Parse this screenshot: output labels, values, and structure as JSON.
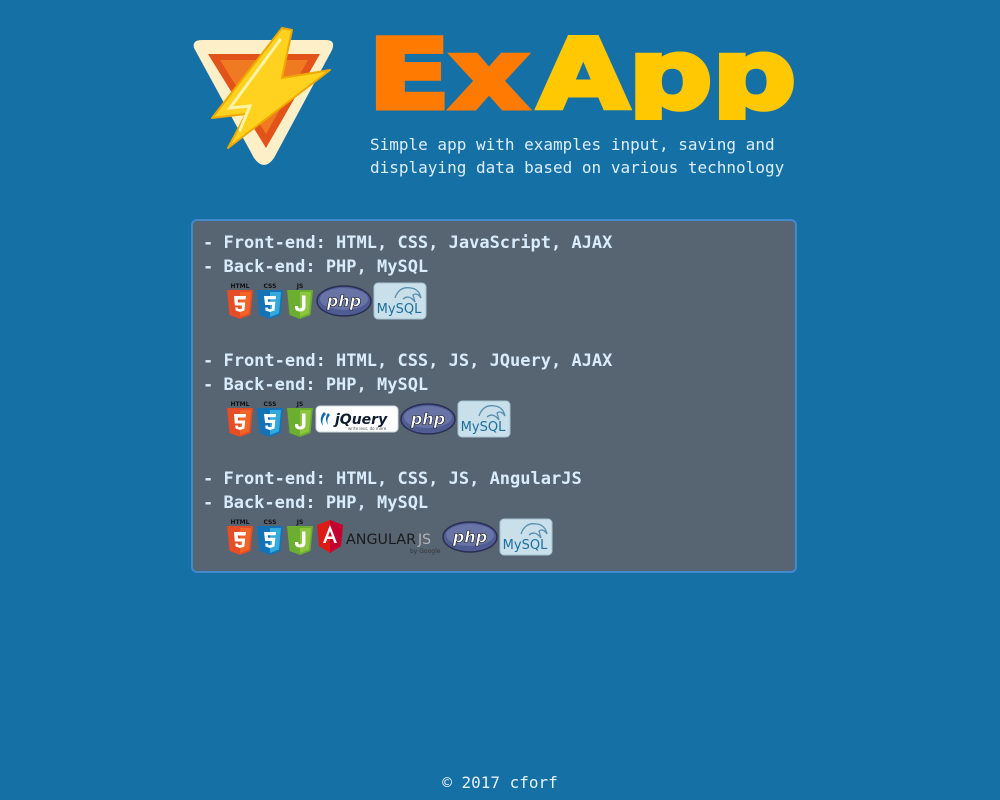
{
  "header": {
    "title_part1": "Ex",
    "title_part2": "App",
    "subtitle_line1": "Simple app with examples input, saving and",
    "subtitle_line2": "displaying data based on various technology"
  },
  "stacks": [
    {
      "frontend": "- Front-end: HTML, CSS, JavaScript, AJAX",
      "backend": "- Back-end: PHP, MySQL",
      "badges": [
        "HTML",
        "CSS",
        "JS",
        "php",
        "MySQL"
      ]
    },
    {
      "frontend": "- Front-end: HTML, CSS, JS, JQuery, AJAX",
      "backend": "- Back-end: PHP, MySQL",
      "badges": [
        "HTML",
        "CSS",
        "JS",
        "jQuery",
        "write less, do more.",
        "php",
        "MySQL"
      ]
    },
    {
      "frontend": "- Front-end: HTML, CSS, JS, AngularJS",
      "backend": "- Back-end: PHP, MySQL",
      "badges": [
        "HTML",
        "CSS",
        "JS",
        "ANGULAR",
        "JS",
        "by Google",
        "php",
        "MySQL"
      ]
    }
  ],
  "footer": {
    "copyright": "© 2017 cforf"
  },
  "colors": {
    "background": "#1570a6",
    "panel": "#576472",
    "panel_border": "#3f89cf",
    "title_orange": "#ff7a00",
    "title_yellow": "#ffc800",
    "html5": "#e44d26",
    "css3": "#1572b6",
    "js": "#6cae2f",
    "php": "#777bb3",
    "mysql_bg": "#c9dfe9",
    "angular": "#dd1b16"
  },
  "icons": {
    "logo": "lightning-bolt-triangle-logo",
    "html5": "html5-shield-icon",
    "css3": "css3-shield-icon",
    "js": "js-shield-icon",
    "php": "php-logo",
    "mysql": "mysql-dolphin-logo",
    "jquery": "jquery-logo",
    "angular": "angularjs-logo"
  }
}
